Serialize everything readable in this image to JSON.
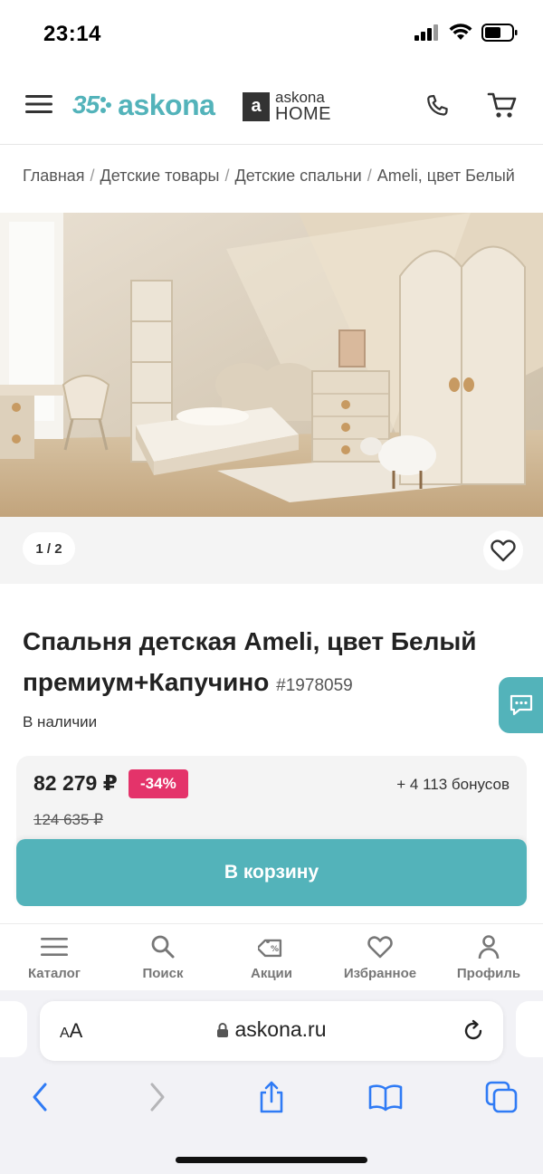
{
  "status": {
    "time": "23:14"
  },
  "header": {
    "logo_number": "35",
    "logo_word": "askona",
    "home_box": "a",
    "home_line1": "askona",
    "home_line2": "HOME"
  },
  "breadcrumb": [
    "Главная",
    "Детские товары",
    "Детские спальни",
    "Ameli, цвет Белый"
  ],
  "gallery": {
    "counter": "1 / 2"
  },
  "product": {
    "title": "Спальня детская Ameli, цвет Белый премиум+Капучино",
    "sku": "#1978059",
    "stock": "В наличии"
  },
  "price": {
    "current": "82 279 ₽",
    "discount": "-34%",
    "bonus": "+ 4 113 бонусов",
    "old": "124 635 ₽"
  },
  "cta": {
    "label": "В корзину"
  },
  "bottom_nav": [
    {
      "label": "Каталог",
      "icon": "catalog-icon"
    },
    {
      "label": "Поиск",
      "icon": "search-icon"
    },
    {
      "label": "Акции",
      "icon": "tag-icon"
    },
    {
      "label": "Избранное",
      "icon": "heart-icon"
    },
    {
      "label": "Профиль",
      "icon": "profile-icon"
    }
  ],
  "safari": {
    "aa_small": "A",
    "aa_large": "A",
    "url": "askona.ru"
  },
  "colors": {
    "brand": "#53b3ba",
    "discount": "#e4336a",
    "ios_blue": "#2f7bf5"
  }
}
